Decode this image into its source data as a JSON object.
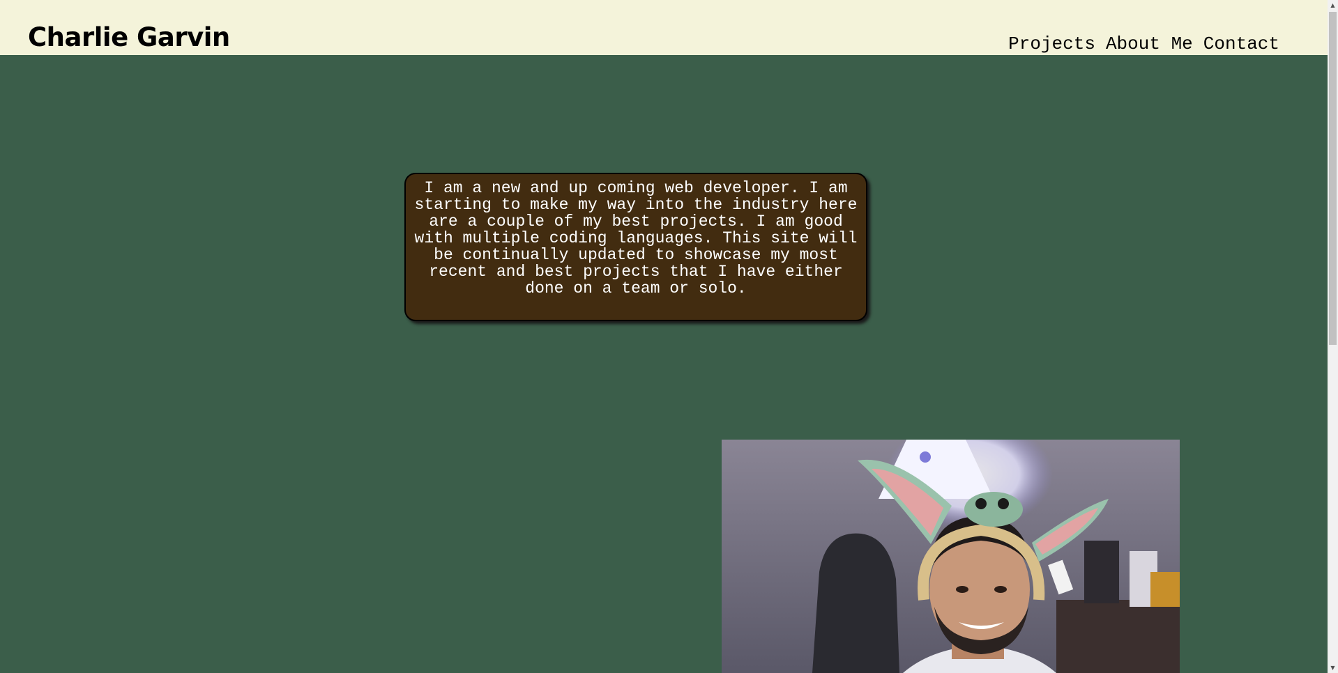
{
  "header": {
    "title": "Charlie Garvin",
    "nav": [
      "Projects",
      "About Me",
      "Contact"
    ]
  },
  "about": {
    "text": "I am a new and up coming web developer. I am starting to make my way into the industry here are a couple of my best projects. I am good with multiple coding languages. This site will be continually updated to showcase my most recent and best projects that I have either done on a team or solo."
  },
  "photo": {
    "alt": ""
  },
  "colors": {
    "header_bg": "#f4f3da",
    "page_bg": "#3b5e4a",
    "about_bg": "#422c10",
    "about_text": "#ffffff"
  },
  "icons": {
    "scroll_up": "triangle-up",
    "scroll_down": "triangle-down"
  }
}
